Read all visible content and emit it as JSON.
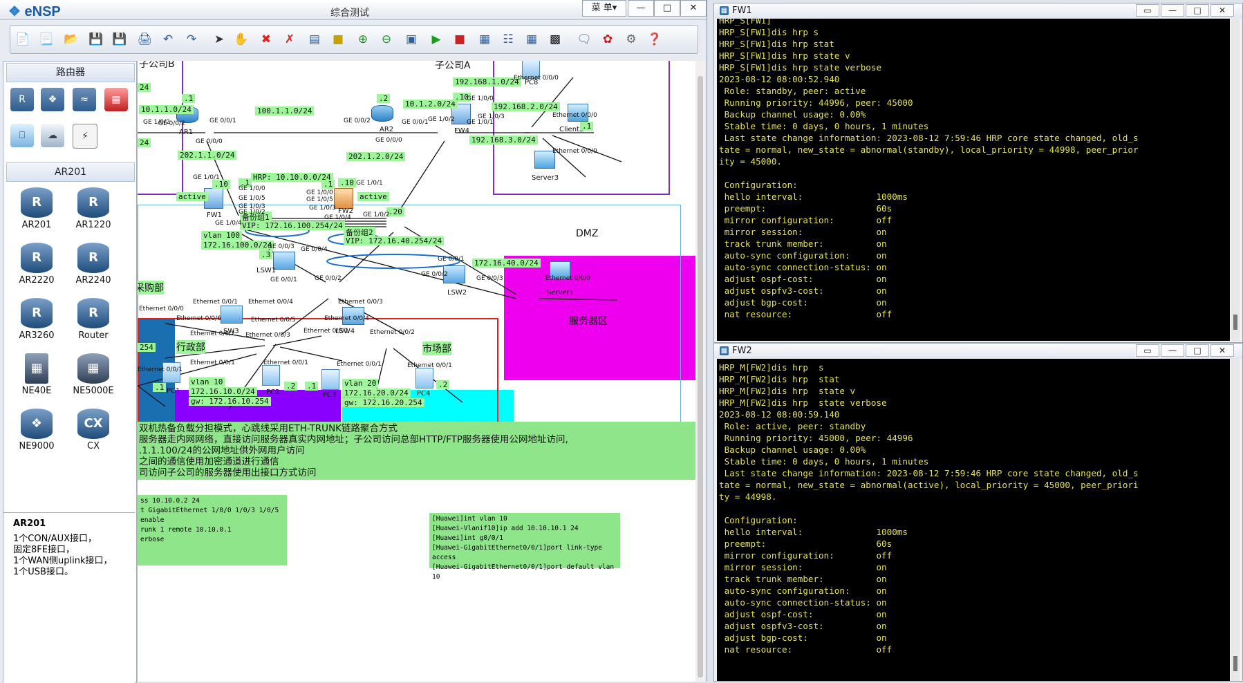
{
  "ensp": {
    "logo": "eNSP",
    "caption": "综合测试",
    "menu_label": "菜 单▾",
    "min": "—",
    "max": "□",
    "close": "✕"
  },
  "toolbar_icons": [
    "new-topo-icon",
    "new-sub-icon",
    "open-icon",
    "save-icon",
    "save-as-icon",
    "print-icon",
    "undo-icon",
    "redo-icon",
    "select-icon",
    "hand-icon",
    "delete-icon",
    "delete-all-icon",
    "text-icon",
    "rectangle-icon",
    "zoom-in-icon",
    "zoom-out-icon",
    "fit-icon",
    "start-icon",
    "stop-icon",
    "capture-icon",
    "topo-icon",
    "grid-icon",
    "console-icon",
    "chat-icon",
    "huawei-icon",
    "settings-icon",
    "help-icon"
  ],
  "left_panel": {
    "section1": "路由器",
    "section2": "AR201",
    "devices": [
      "AR201",
      "AR1220",
      "AR2220",
      "AR2240",
      "AR3260",
      "Router",
      "NE40E",
      "NE5000E",
      "NE9000",
      "CX"
    ],
    "info_title": "AR201",
    "info_lines": [
      "1个CON/AUX接口，",
      "固定8FE接口，",
      "1个WAN侧uplink接口，",
      "1个USB接口。"
    ]
  },
  "topology": {
    "areas": [
      "子公司B",
      "子公司A",
      "DMZ",
      "服务器区",
      "采购部",
      "行政部",
      "市场部"
    ],
    "labels": {
      "n1": "10.1.1.0/24",
      "n2": "100.1.1.0/24",
      "n3": "10.1.2.0/24",
      "n4": "192.168.1.0/24",
      "n5": "192.168.2.0/24",
      "n6": "192.168.3.0/24",
      "n7": "202.1.1.0/24",
      "n8": "202.1.2.0/24",
      "n9": "HRP: 10.10.0.0/24",
      "n10": "active",
      "n11": "active",
      "n12": "备份组1",
      "n13": "VIP: 172.16.100.254/24",
      "n14": "备份组2",
      "n15": "VIP: 172.16.40.254/24",
      "n16": "vlan 100",
      "n17": "172.16.100.0/24",
      "n18": "172.16.40.0/24",
      "n19": "vlan 10",
      "n20": "172.16.10.0/24",
      "n21": "gw: 172.16.10.254",
      "n22": "vlan 20",
      "n23": "172.16.20.0/24",
      "n24": "gw: 172.16.20.254",
      "n25": "254",
      "n26": "24",
      "n27": "24"
    },
    "dots": {
      ".1a": ".1",
      ".2a": ".2",
      ".10a": ".10",
      ".1b": ".1",
      ".10b": ".10",
      ".1c": ".1",
      ".2b": ".2",
      ".10c": ".10",
      ".20": ".20",
      ".3": ".3",
      ".1d": ".1",
      ".1e": ".1",
      ".2c": ".2",
      ".1f": ".1",
      ".2d": ".2"
    },
    "ports": {
      "p1": "GE 1/0/2",
      "p2": "GE 0/0/2",
      "p3": "GE 0/0/1",
      "p4": "GE 0/0/2",
      "p5": "GE 0/0/1",
      "p6": "GE 1/0/2",
      "p7": "GE 1/0/0",
      "p8": "GE 1/0/3",
      "p9": "GE 1/0/1",
      "p10": "GE 0/0/0",
      "p11": "GE 0/0/0",
      "p12": "GE 1/0/1",
      "p13": "GE 1/0/1",
      "p14": "GE 1/0/0",
      "p15": "GE 1/0/0",
      "p16": "GE 1/0/5",
      "p17": "GE 1/0/3",
      "p18": "GE 1/0/2",
      "p19": "GE 1/0/4",
      "p20": "GE 1/0/5",
      "p21": "GE 1/0/3",
      "p22": "GE 1/0/4",
      "p23": "GE 1/0/2",
      "p24": "GE 0/0/3",
      "p25": "GE 0/0/4",
      "p26": "GE 0/0/1",
      "p27": "GE 0/0/2",
      "p28": "GE 0/0/1",
      "p29": "GE 0/0/2",
      "p30": "GE 0/0/3",
      "p31": "Ethernet 0/0/1",
      "p32": "Ethernet 0/0/0",
      "p33": "Ethernet 0/0/0",
      "p34": "Ethernet 0/0/0",
      "p35": "Ethernet 0/0/1",
      "p36": "Ethernet 0/0/4",
      "p37": "Ethernet 0/0/3",
      "p38": "Ethernet 0/0/6",
      "p39": "Ethernet 0/0/5",
      "p40": "Ethernet 0/0/4",
      "p41": "Ethernet 0/0/2",
      "p42": "Ethernet 0/0/3",
      "p43": "Ethernet 0/0/1",
      "p44": "Ethernet 0/0/2",
      "p45": "Ethernet 0/0/1",
      "p46": "Ethernet 0/0/1",
      "p47": "Ethernet 0/0/1",
      "p48": "Ethernet 0/0/1",
      "p49": "Ethernet 0/0/0",
      "p50": "Ethernet 0/0/0"
    },
    "devices": {
      "ar1": "AR1",
      "ar2": "AR2",
      "fw1": "FW1",
      "fw2": "FW2",
      "fw4": "FW4",
      "lsw1": "LSW1",
      "lsw2": "LSW2",
      "sw3": "SW3",
      "sw4": "LSW4",
      "pc1": "PC1",
      "pc2": "PC2",
      "pc3": "PC3",
      "pc4": "PC4",
      "pc8": "PC8",
      "client2": "Client2",
      "server3": "Server3",
      "server1": "Server1"
    },
    "notes": [
      "双机热备负载分担模式，心跳线采用ETH-TRUNK链路聚合方式",
      "服务器走内网网络，直接访问服务器真实内网地址；子公司访问总部HTTP/FTP服务器使用公网地址访问,",
      ".1.1.100/24的公网地址供外网用户访问",
      "之间的通信使用加密通道进行通信",
      "司访问子公司的服务器使用出接口方式访问"
    ],
    "code1": [
      "ss 10.10.0.2 24",
      "t GigabitEthernet 1/0/0 1/0/3 1/0/5",
      "",
      "enable",
      "runk 1 remote 10.10.0.1",
      "",
      "erbose"
    ],
    "code2": [
      "[Huawei]int vlan 10",
      "[Huawei-Vlanif10]ip add 10.10.10.1 24",
      "[Huawei]int g0/0/1",
      "[Huawei-GigabitEthernet0/0/1]port link-type access",
      "[Huawei-GigabitEthernet0/0/1]port default vlan 10"
    ]
  },
  "fw1": {
    "title": "FW1",
    "lines": [
      "HRP_S[FW1]",
      "HRP_S[FW1]dis hrp s",
      "HRP_S[FW1]dis hrp stat",
      "HRP_S[FW1]dis hrp state v",
      "HRP_S[FW1]dis hrp state verbose",
      "2023-08-12 08:00:52.940",
      " Role: standby, peer: active",
      " Running priority: 44996, peer: 45000",
      " Backup channel usage: 0.00%",
      " Stable time: 0 days, 0 hours, 1 minutes",
      " Last state change information: 2023-08-12 7:59:46 HRP core state changed, old_s",
      "tate = normal, new_state = abnormal(standby), local_priority = 44998, peer_prior",
      "ity = 45000.",
      "",
      " Configuration:",
      " hello interval:              1000ms",
      " preempt:                     60s",
      " mirror configuration:        off",
      " mirror session:              on",
      " track trunk member:          on",
      " auto-sync configuration:     on",
      " auto-sync connection-status: on",
      " adjust ospf-cost:            on",
      " adjust ospfv3-cost:          on",
      " adjust bgp-cost:             on",
      " nat resource:                off"
    ]
  },
  "fw2": {
    "title": "FW2",
    "lines": [
      "HRP_M[FW2]dis hrp  s",
      "HRP_M[FW2]dis hrp  stat",
      "HRP_M[FW2]dis hrp  state v",
      "HRP_M[FW2]dis hrp  state verbose",
      "2023-08-12 08:00:59.140",
      " Role: active, peer: standby",
      " Running priority: 45000, peer: 44996",
      " Backup channel usage: 0.00%",
      " Stable time: 0 days, 0 hours, 1 minutes",
      " Last state change information: 2023-08-12 7:59:46 HRP core state changed, old_s",
      "tate = normal, new_state = abnormal(active), local_priority = 45000, peer_priori",
      "ty = 44998.",
      "",
      " Configuration:",
      " hello interval:              1000ms",
      " preempt:                     60s",
      " mirror configuration:        off",
      " mirror session:              on",
      " track trunk member:          on",
      " auto-sync configuration:     on",
      " auto-sync connection-status: on",
      " adjust ospf-cost:            on",
      " adjust ospfv3-cost:          on",
      " adjust bgp-cost:             on",
      " nat resource:                off"
    ]
  },
  "console_buttons": {
    "restore": "▭",
    "min": "—",
    "max": "□",
    "close": "✕"
  },
  "colors": {
    "terminal_text": "#e7e250",
    "label_bg": "#9ef59a",
    "dmz": "#ee00ee",
    "admin": "#8a00ff",
    "market": "#00ffff",
    "purchase": "#1a6fb0"
  }
}
